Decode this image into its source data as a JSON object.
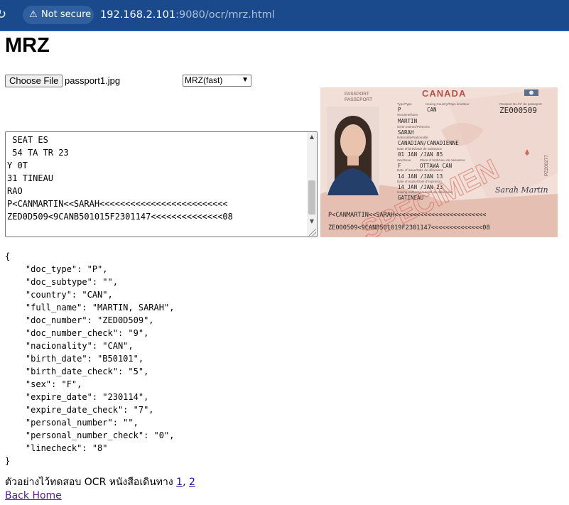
{
  "browser": {
    "security_label": "Not secure",
    "url_host": "192.168.2.101",
    "url_rest": ":9080/ocr/mrz.html"
  },
  "page": {
    "title": "MRZ"
  },
  "upload": {
    "button_label": "Choose File",
    "file_name": "passport1.jpg"
  },
  "mode_select": {
    "selected": "MRZ(fast)"
  },
  "ocr_text": {
    "lines": [
      " SEAT ES",
      " 54 TA TR 23",
      "Y 0T",
      "31 TINEAU",
      "RAO",
      "P<CANMARTIN<<SARAH<<<<<<<<<<<<<<<<<<<<<<<<<",
      "ZED0D509<9CANB501015F2301147<<<<<<<<<<<<<<08"
    ]
  },
  "passport_image": {
    "header_left_1": "PASSPORT",
    "header_left_2": "PASSEPORT",
    "country": "CANADA",
    "type_label": "Type/Type",
    "type_value": "P",
    "issuing_label": "Issuing Country/Pays émetteur",
    "issuing_value": "CAN",
    "passport_no_label": "Passport No./N° de passeport",
    "passport_no_value": "ZE000509",
    "surname_label": "Surname/Nom",
    "surname_value": "MARTIN",
    "given_label": "Given names/Prénoms",
    "given_value": "SARAH",
    "nationality_label": "Nationality/Nationalité",
    "nationality_value": "CANADIAN/CANADIENNE",
    "dob_label": "Date of birth/Date de naissance",
    "dob_value": "01 JAN /JAN 85",
    "sex_label": "Sex/Sexe",
    "sex_value": "F",
    "pob_label": "Place of birth/Lieu de naissance",
    "pob_value": "OTTAWA CAN",
    "issue_label": "Date of issue/Date de délivrance",
    "issue_value": "14 JAN /JAN 13",
    "expiry_label": "Date of expiry/Date d'expiration",
    "expiry_value": "14 JAN /JAN 23",
    "authority_label": "Issuing Authority/Autorité de délivrance",
    "authority_value": "GATINEAU",
    "specimen": "SPECIMEN",
    "signature": "Sarah Martin",
    "side_number": "PZ200277",
    "mrz_line1": "P<CANMARTIN<<SARAH<<<<<<<<<<<<<<<<<<<<<<<<<",
    "mrz_line2": "ZE000509<9CAN8501019F2301147<<<<<<<<<<<<<<08"
  },
  "json_result": {
    "lines": [
      "{",
      "    \"doc_type\": \"P\",",
      "    \"doc_subtype\": \"\",",
      "    \"country\": \"CAN\",",
      "    \"full_name\": \"MARTIN, SARAH\",",
      "    \"doc_number\": \"ZED0D509\",",
      "    \"doc_number_check\": \"9\",",
      "    \"nacionality\": \"CAN\",",
      "    \"birth_date\": \"B50101\",",
      "    \"birth_date_check\": \"5\",",
      "    \"sex\": \"F\",",
      "    \"expire_date\": \"230114\",",
      "    \"expire_date_check\": \"7\",",
      "    \"personal_number\": \"\",",
      "    \"personal_number_check\": \"0\",",
      "    \"linecheck\": \"8\"",
      "}"
    ]
  },
  "footer": {
    "note": "ตัวอย่างไว้ทดสอบ OCR หนังสือเดินทาง ",
    "link1": "1",
    "separator": ", ",
    "link2": "2",
    "back_home": "Back Home"
  },
  "colors": {
    "browser_bar": "#1b4a8c",
    "link": "#1a0dab",
    "visited_link": "#551a8b",
    "passport_accent": "#c0392b"
  }
}
